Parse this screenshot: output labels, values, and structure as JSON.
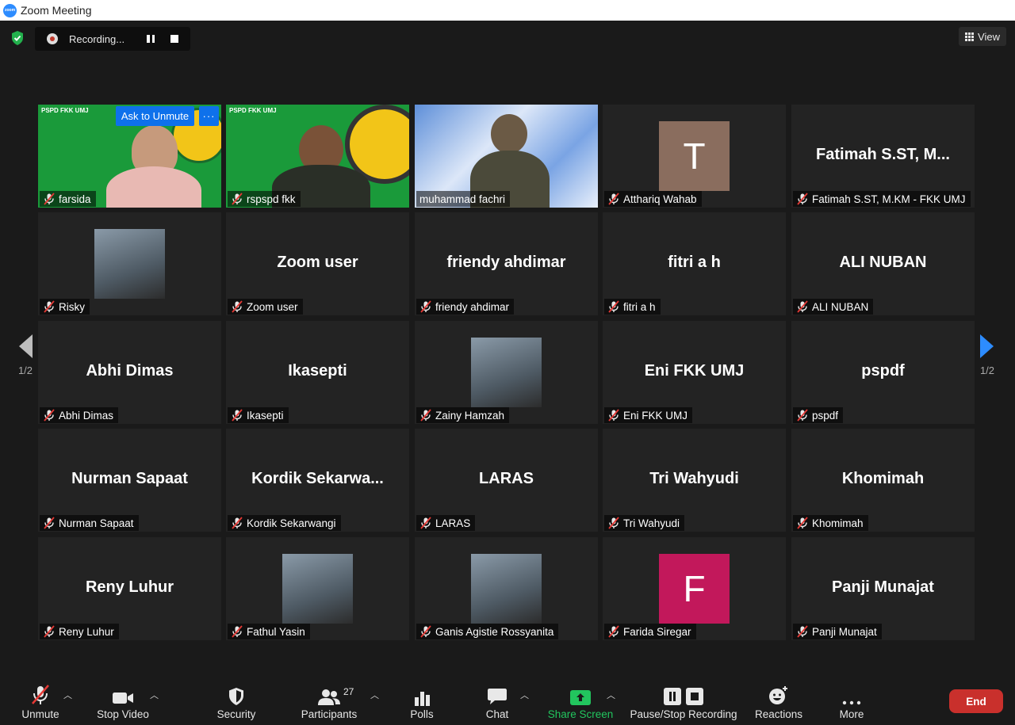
{
  "window": {
    "title": "Zoom Meeting",
    "logo_text": "zoom"
  },
  "recording": {
    "label": "Recording..."
  },
  "view": {
    "label": "View"
  },
  "ask_unmute": {
    "label": "Ask to Unmute",
    "more": "···"
  },
  "pagination": {
    "left": "1/2",
    "right": "1/2"
  },
  "tiles": [
    {
      "name": "farsida",
      "type": "video",
      "mic_off": true
    },
    {
      "name": "rspspd fkk",
      "type": "video",
      "mic_off": true
    },
    {
      "name": "muhammad fachri",
      "type": "video",
      "mic_off": false,
      "active_speaker": true
    },
    {
      "name": "Atthariq Wahab",
      "type": "avatar-letter",
      "letter": "T",
      "avatar_color": "#8a6d5e",
      "mic_off": true
    },
    {
      "name": "Fatimah S.ST, M.KM - FKK UMJ",
      "display": "Fatimah  S.ST,  M...",
      "type": "name",
      "mic_off": true
    },
    {
      "name": "Risky",
      "type": "avatar-photo",
      "mic_off": true
    },
    {
      "name": "Zoom user",
      "display": "Zoom user",
      "type": "name",
      "mic_off": true
    },
    {
      "name": "friendy ahdimar",
      "display": "friendy ahdimar",
      "type": "name",
      "mic_off": true
    },
    {
      "name": "fitri a h",
      "display": "fitri a h",
      "type": "name",
      "mic_off": true
    },
    {
      "name": "ALI NUBAN",
      "display": "ALI NUBAN",
      "type": "name",
      "mic_off": true
    },
    {
      "name": "Abhi Dimas",
      "display": "Abhi Dimas",
      "type": "name",
      "mic_off": true
    },
    {
      "name": "Ikasepti",
      "display": "Ikasepti",
      "type": "name",
      "mic_off": true
    },
    {
      "name": "Zainy Hamzah",
      "type": "avatar-photo",
      "mic_off": true
    },
    {
      "name": "Eni FKK UMJ",
      "display": "Eni FKK UMJ",
      "type": "name",
      "mic_off": true
    },
    {
      "name": "pspdf",
      "display": "pspdf",
      "type": "name",
      "mic_off": true
    },
    {
      "name": "Nurman Sapaat",
      "display": "Nurman Sapaat",
      "type": "name",
      "mic_off": true
    },
    {
      "name": "Kordik Sekarwangi",
      "display": "Kordik  Sekarwa...",
      "type": "name",
      "mic_off": true
    },
    {
      "name": "LARAS",
      "display": "LARAS",
      "type": "name",
      "mic_off": true
    },
    {
      "name": "Tri Wahyudi",
      "display": "Tri Wahyudi",
      "type": "name",
      "mic_off": true
    },
    {
      "name": "Khomimah",
      "display": "Khomimah",
      "type": "name",
      "mic_off": true
    },
    {
      "name": "Reny Luhur",
      "display": "Reny Luhur",
      "type": "name",
      "mic_off": true
    },
    {
      "name": "Fathul Yasin",
      "type": "avatar-photo",
      "mic_off": true
    },
    {
      "name": "Ganis Agistie Rossyanita",
      "type": "avatar-photo",
      "mic_off": true
    },
    {
      "name": "Farida Siregar",
      "type": "avatar-letter",
      "letter": "F",
      "avatar_color": "#c2185b",
      "mic_off": true
    },
    {
      "name": "Panji Munajat",
      "display": "Panji Munajat",
      "type": "name",
      "mic_off": true
    }
  ],
  "toolbar": {
    "unmute": "Unmute",
    "stop_video": "Stop Video",
    "security": "Security",
    "participants": "Participants",
    "participants_count": "27",
    "polls": "Polls",
    "chat": "Chat",
    "share_screen": "Share Screen",
    "pause_stop_recording": "Pause/Stop Recording",
    "reactions": "Reactions",
    "more": "More",
    "end": "End"
  },
  "colors": {
    "accent": "#0e71eb",
    "share_green": "#22c55e",
    "end_red": "#c9302c",
    "active_speaker": "#d8e36a"
  }
}
